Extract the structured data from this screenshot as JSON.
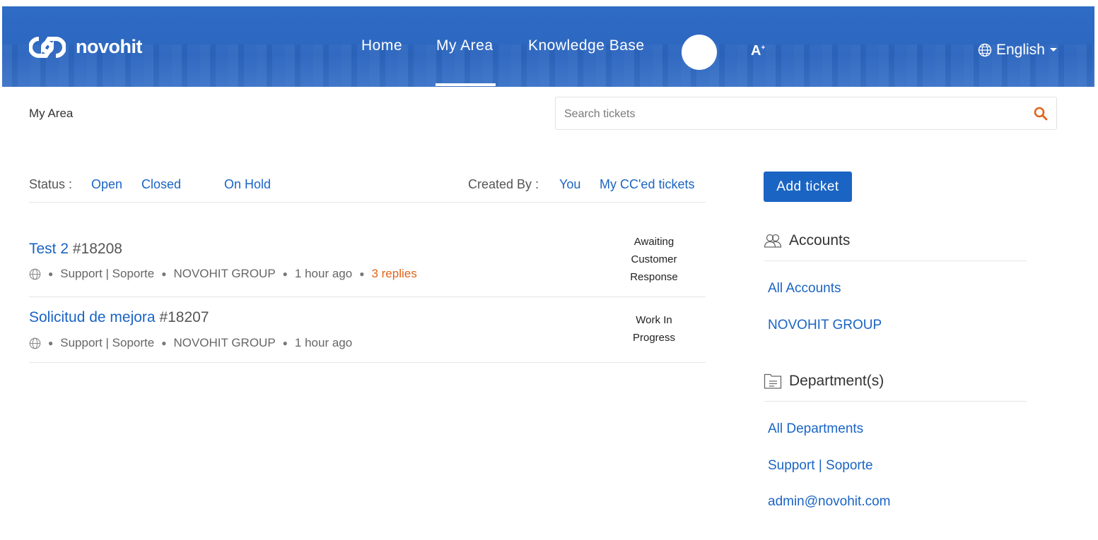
{
  "brand": {
    "name": "novohit"
  },
  "nav": {
    "home": "Home",
    "my_area": "My Area",
    "kb": "Knowledge Base",
    "font_size": "A",
    "language": "English"
  },
  "breadcrumb": "My Area",
  "search": {
    "placeholder": "Search tickets"
  },
  "filters": {
    "status_label": "Status :",
    "status": [
      "Open",
      "Closed",
      "On Hold"
    ],
    "created_label": "Created By :",
    "created": [
      "You",
      "My CC'ed tickets"
    ]
  },
  "tickets": [
    {
      "subject": "Test 2",
      "number": "#18208",
      "department": "Support | Soporte",
      "account": "NOVOHIT GROUP",
      "time": "1 hour ago",
      "replies": "3 replies",
      "status_lines": [
        "Awaiting",
        "Customer",
        "Response"
      ]
    },
    {
      "subject": "Solicitud de mejora",
      "number": "#18207",
      "department": "Support | Soporte",
      "account": "NOVOHIT GROUP",
      "time": "1 hour ago",
      "status_lines": [
        "Work In",
        "Progress"
      ]
    }
  ],
  "sidebar": {
    "add_ticket": "Add ticket",
    "accounts_title": "Accounts",
    "accounts": [
      "All Accounts",
      "NOVOHIT GROUP"
    ],
    "departments_title": "Department(s)",
    "departments": [
      "All Departments",
      "Support | Soporte",
      "admin@novohit.com"
    ]
  },
  "colors": {
    "brand_blue": "#1a64c4",
    "header_blue": "#2f6cc6",
    "accent_orange": "#e0641c"
  }
}
